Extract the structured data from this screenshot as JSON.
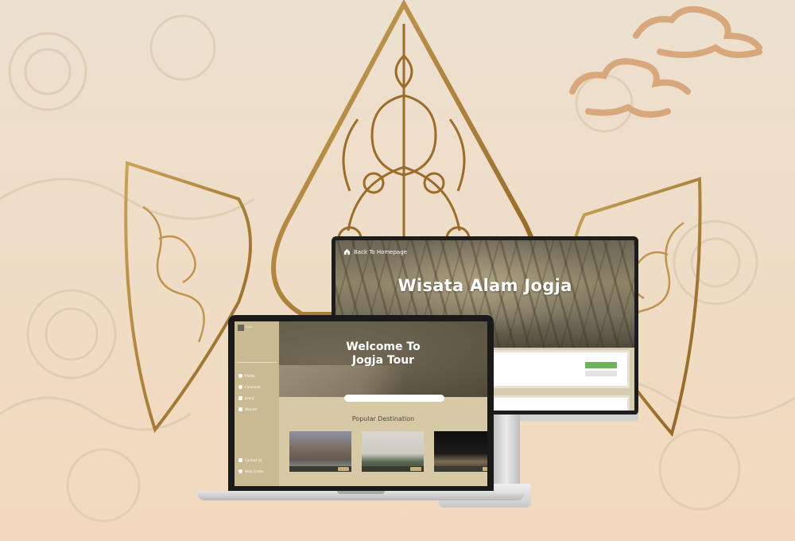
{
  "monitor": {
    "back_label": "Back To Homepage",
    "title": "Wisata Alam Jogja",
    "cards": [
      {
        "text": "",
        "primary_btn": "",
        "secondary_btn": ""
      },
      {
        "text": "",
        "primary_btn": ""
      }
    ]
  },
  "laptop": {
    "sidebar": {
      "user": "Rafa",
      "subtitle": "",
      "nav": [
        {
          "label": "Profile",
          "icon": "person-icon"
        },
        {
          "label": "Comment",
          "icon": "comment-icon"
        },
        {
          "label": "Event",
          "icon": "calendar-icon"
        },
        {
          "label": "Wishlist",
          "icon": "bookmark-icon"
        }
      ],
      "bottom_nav": [
        {
          "label": "Contact Us",
          "icon": "phone-icon"
        },
        {
          "label": "Help Center",
          "icon": "help-icon"
        }
      ]
    },
    "hero": {
      "title_line1": "Welcome To",
      "title_line2": "Jogja Tour",
      "description": "",
      "search_placeholder": ""
    },
    "popular_heading": "Popular Destination",
    "destinations": [
      {
        "tag": "",
        "caption": ""
      },
      {
        "tag": "",
        "caption": ""
      },
      {
        "tag": "",
        "caption": ""
      }
    ]
  },
  "colors": {
    "background": "#eedfca",
    "ornament_gold": "#b4873c",
    "cloud": "#d8a87c",
    "sidebar": "#c9ba92",
    "button_green": "#6db35c"
  }
}
